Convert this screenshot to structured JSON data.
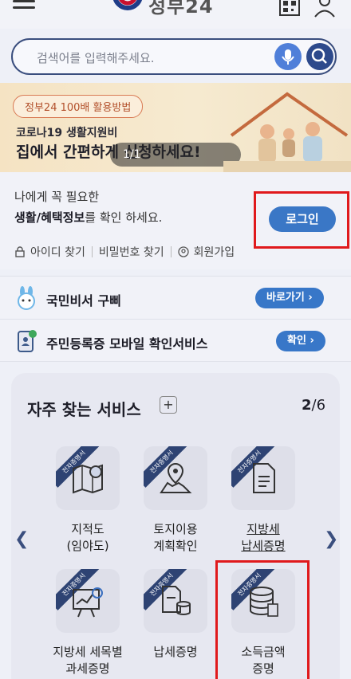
{
  "header": {
    "logo_text": "정부24",
    "hamburger_icon": "menu-icon",
    "qr_icon": "qr-icon",
    "user_icon": "user-icon"
  },
  "search": {
    "placeholder": "검색어를 입력해주세요.",
    "mic_icon": "mic-icon",
    "search_icon": "search-icon"
  },
  "banner": {
    "tag": "정부24 100배 활용방법",
    "subtitle": "코로나19 생활지원비",
    "title": "집에서 간편하게 신청하세요!",
    "pager": "1/1"
  },
  "login": {
    "line1": "나에게 꼭 필요한",
    "line2_bold": "생활/혜택정보",
    "line2_rest": "를 확인 하세요.",
    "button": "로그인",
    "links": [
      "아이디 찾기",
      "비밀번호 찾기",
      "회원가입"
    ]
  },
  "services": [
    {
      "label": "국민비서 구삐",
      "button": "바로가기 ›"
    },
    {
      "label": "주민등록증 모바일 확인서비스",
      "button": "확인 ›"
    }
  ],
  "frequent": {
    "title": "자주 찾는 서비스",
    "plus": "+",
    "page_current": "2",
    "page_total": "6",
    "ribbon": "전자증명서",
    "tiles": [
      {
        "line1": "지적도",
        "line2": "(임야도)",
        "icon": "map-icon"
      },
      {
        "line1": "토지이용",
        "line2": "계획확인",
        "icon": "location-map-icon"
      },
      {
        "line1": "지방세",
        "line2": "납세증명",
        "icon": "document-icon"
      },
      {
        "line1": "지방세 세목별",
        "line2": "과세증명",
        "icon": "chart-board-icon"
      },
      {
        "line1": "납세증명",
        "line2": "",
        "icon": "document-coins-icon"
      },
      {
        "line1": "소득금액",
        "line2": "증명",
        "icon": "database-icon"
      }
    ]
  },
  "colors": {
    "primary": "#3877c8",
    "navy": "#2e4373",
    "highlight_box": "#e0191c"
  }
}
